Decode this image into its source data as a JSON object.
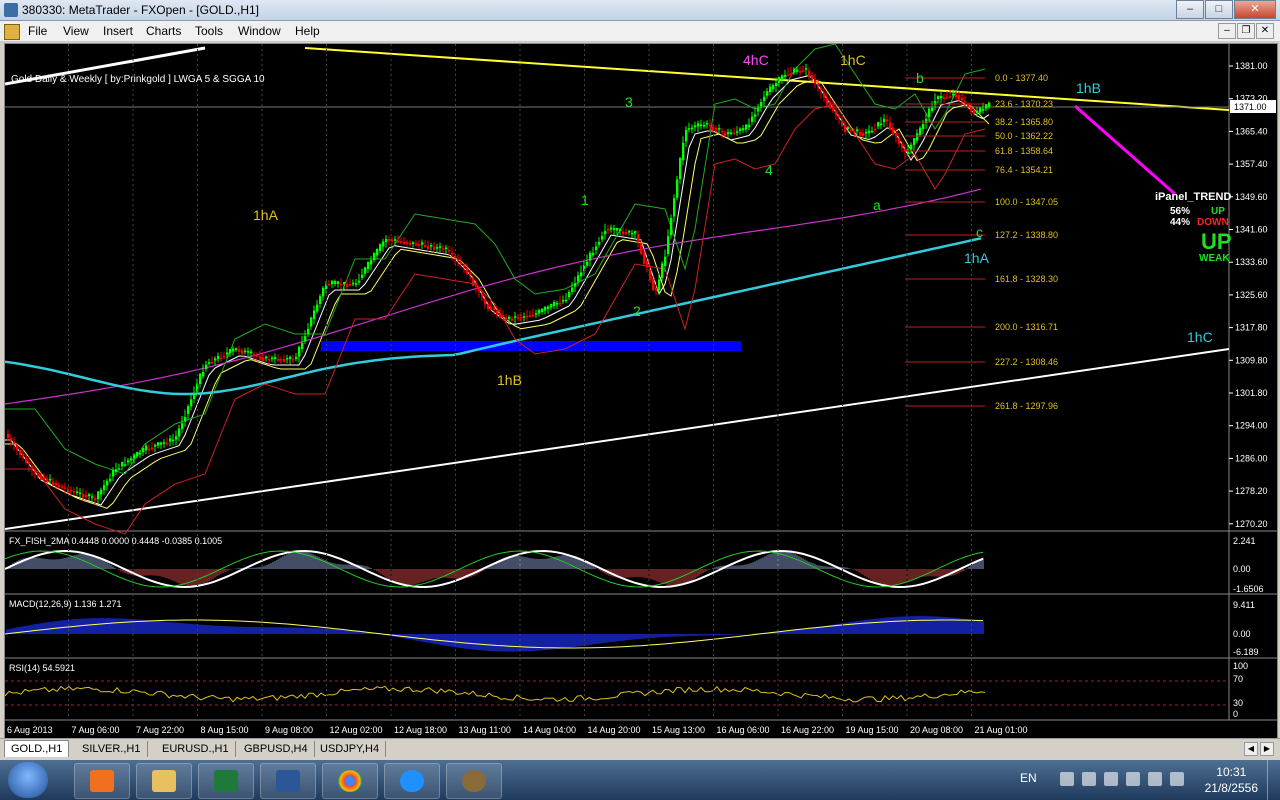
{
  "window": {
    "title": "380330: MetaTrader - FXOpen - [GOLD.,H1]",
    "min": "–",
    "max": "□",
    "close": "✕"
  },
  "menu": {
    "items": [
      "File",
      "View",
      "Insert",
      "Charts",
      "Tools",
      "Window",
      "Help"
    ]
  },
  "chart": {
    "caption": "Gold Daily & Weekly [ by:Prinkgold ]  LWGA 5  &  SGGA 10",
    "current_price": "1371.00",
    "price_scale": [
      "1381.00",
      "1373.20",
      "1365.40",
      "1357.40",
      "1349.60",
      "1341.60",
      "1333.60",
      "1325.60",
      "1317.80",
      "1309.80",
      "1301.80",
      "1294.00",
      "1286.00",
      "1278.20",
      "1270.20"
    ],
    "time_scale": [
      "6 Aug 2013",
      "7 Aug 06:00",
      "7 Aug 22:00",
      "8 Aug 15:00",
      "9 Aug 08:00",
      "12 Aug 02:00",
      "12 Aug 18:00",
      "13 Aug 11:00",
      "14 Aug 04:00",
      "14 Aug 20:00",
      "15 Aug 13:00",
      "16 Aug 06:00",
      "16 Aug 22:00",
      "19 Aug 15:00",
      "20 Aug 08:00",
      "21 Aug 01:00"
    ],
    "fib_levels": [
      "0.0 - 1377.40",
      "23.6 - 1370.23",
      "38.2 - 1365.80",
      "50.0 - 1362.22",
      "61.8 - 1358.64",
      "76.4 - 1354.21",
      "100.0 - 1347.05",
      "127.2 - 1338.80",
      "161.8 - 1328.30",
      "200.0 - 1316.71",
      "227.2 - 1308.46",
      "261.8 - 1297.96"
    ],
    "wave_labels": {
      "w_1hA_left": "1hA",
      "w_1hB_mid": "1hB",
      "w_1": "1",
      "w_2": "2",
      "w_3": "3",
      "w_4": "4",
      "w_4hC": "4hC",
      "w_1hC_top": "1hC",
      "w_b": "b",
      "w_a": "a",
      "w_c": "c",
      "w_1hA_right": "1hA",
      "w_1hB_right": "1hB",
      "w_1hC_right": "1hC"
    },
    "ipanel": {
      "title": "iPanel_TREND",
      "pct_up": "56%",
      "pct_down": "44%",
      "up": "UP",
      "down": "DOWN",
      "big": "UP",
      "weak": "WEAK"
    }
  },
  "indicators": {
    "fish": {
      "caption": "FX_FISH_2MA 0.4448 0.0000 0.4448 -0.0385 0.1005",
      "scale": [
        "2.241",
        "0.00",
        "-1.6506"
      ]
    },
    "macd": {
      "caption": "MACD(12,26,9) 1.136 1.271",
      "scale": [
        "9.411",
        "0.00",
        "-6.189"
      ]
    },
    "rsi": {
      "caption": "RSI(14) 54.5921",
      "scale": [
        "100",
        "70",
        "30",
        "0"
      ]
    }
  },
  "tabs": [
    "GOLD.,H1",
    "SILVER.,H1",
    "EURUSD.,H1",
    "GBPUSD,H4",
    "USDJPY,H4"
  ],
  "taskbar": {
    "lang": "EN",
    "time": "10:31",
    "date": "21/8/2556"
  },
  "colors": {
    "bull": "#00ff00",
    "bear": "#ff0000",
    "trendline_yellow": "#ffff33",
    "cyan_ma": "#33ccdd",
    "magenta_ma": "#cc33cc",
    "blue_zone": "#0000ff"
  }
}
